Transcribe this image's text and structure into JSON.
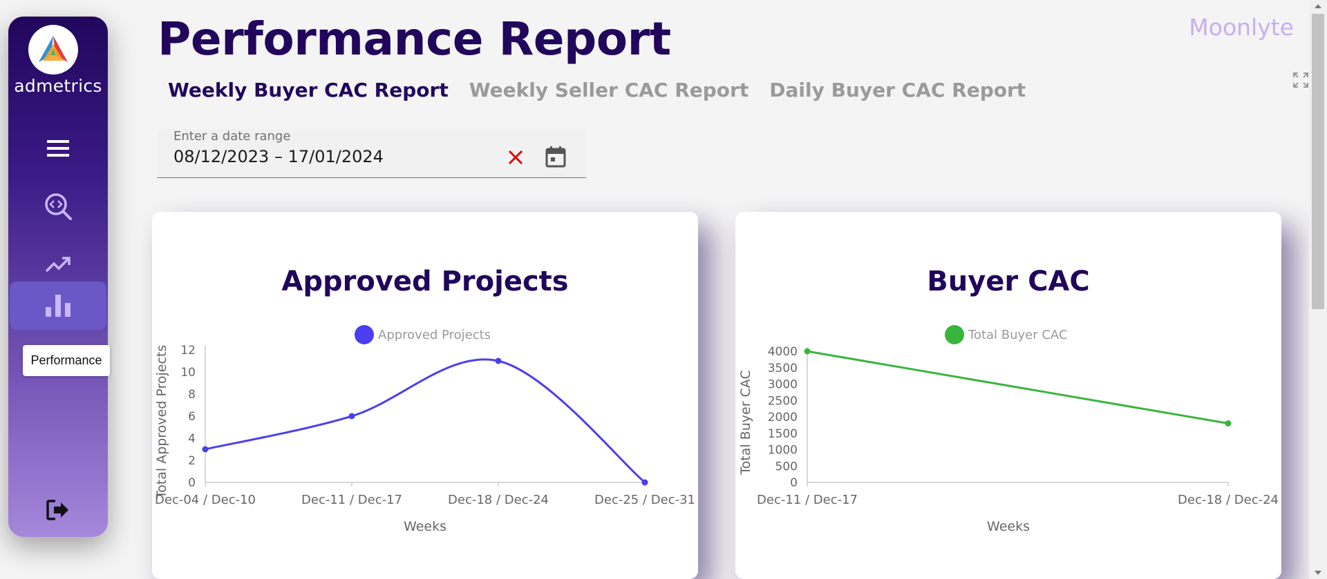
{
  "app": {
    "name": "admetrics",
    "brand": "Moonlyte"
  },
  "page": {
    "title": "Performance Report"
  },
  "tabs": [
    {
      "label": "Weekly Buyer CAC Report",
      "active": true
    },
    {
      "label": "Weekly Seller CAC Report",
      "active": false
    },
    {
      "label": "Daily Buyer CAC Report",
      "active": false
    }
  ],
  "sidebar": {
    "items": [
      {
        "icon": "menu-icon"
      },
      {
        "icon": "code-search-icon"
      },
      {
        "icon": "trending-up-icon"
      },
      {
        "icon": "bar-chart-icon",
        "active": true,
        "tooltip": "Performance"
      },
      {
        "icon": "logout-icon"
      }
    ]
  },
  "date_range": {
    "label": "Enter a date range",
    "value": "08/12/2023 – 17/01/2024"
  },
  "colors": {
    "primary": "#21065c",
    "accent_brand": "#c7aff2",
    "series_blue": "#4a3ef0",
    "series_green": "#38b53c",
    "clear_red": "#e00000"
  },
  "chart_data": [
    {
      "type": "line",
      "title": "Approved Projects",
      "xlabel": "Weeks",
      "ylabel": "Total Approved Projects",
      "categories": [
        "Dec-04 / Dec-10",
        "Dec-11 / Dec-17",
        "Dec-18 / Dec-24",
        "Dec-25 / Dec-31"
      ],
      "series": [
        {
          "name": "Approved Projects",
          "values": [
            3,
            6,
            11,
            0
          ]
        }
      ],
      "ylim": [
        0,
        12
      ],
      "yticks": [
        "0",
        "2",
        "4",
        "6",
        "8",
        "10",
        "12"
      ],
      "smooth": true,
      "legend": "top-center",
      "grid": false
    },
    {
      "type": "line",
      "title": "Buyer CAC",
      "xlabel": "Weeks",
      "ylabel": "Total Buyer CAC",
      "categories": [
        "Dec-11 / Dec-17",
        "Dec-18 / Dec-24"
      ],
      "series": [
        {
          "name": "Total Buyer CAC",
          "values": [
            4000,
            1800
          ]
        }
      ],
      "ylim": [
        0,
        4000
      ],
      "yticks": [
        "0",
        "500",
        "1000",
        "1500",
        "2000",
        "2500",
        "3000",
        "3500",
        "4000"
      ],
      "smooth": false,
      "legend": "top-center",
      "grid": false
    }
  ]
}
